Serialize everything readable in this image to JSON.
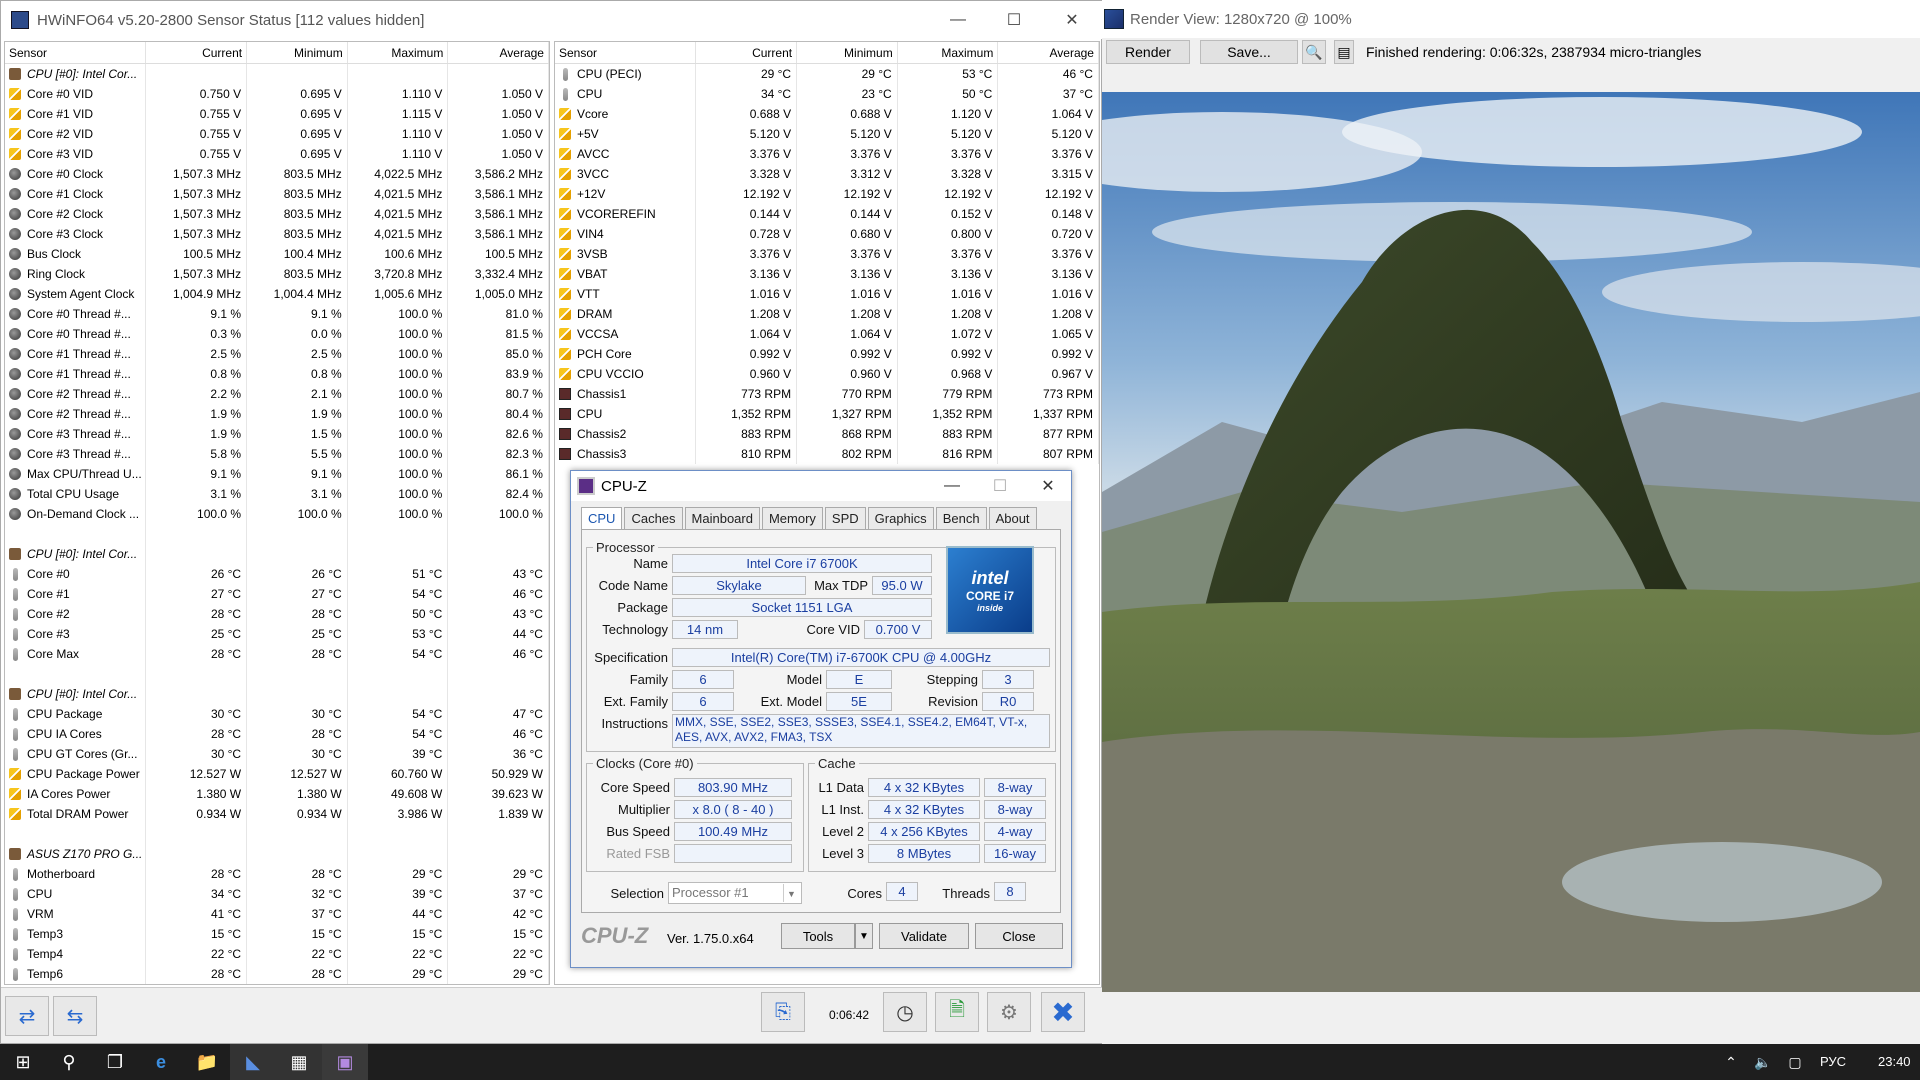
{
  "hwinfo": {
    "title": "HWiNFO64 v5.20-2800 Sensor Status [112 values hidden]",
    "columns": [
      "Sensor",
      "Current",
      "Minimum",
      "Maximum",
      "Average"
    ],
    "left_rows": [
      [
        "grp",
        "CPU [#0]: Intel Cor...",
        "",
        "",
        "",
        ""
      ],
      [
        "bolt",
        "Core #0 VID",
        "0.750 V",
        "0.695 V",
        "1.110 V",
        "1.050 V"
      ],
      [
        "bolt",
        "Core #1 VID",
        "0.755 V",
        "0.695 V",
        "1.115 V",
        "1.050 V"
      ],
      [
        "bolt",
        "Core #2 VID",
        "0.755 V",
        "0.695 V",
        "1.110 V",
        "1.050 V"
      ],
      [
        "bolt",
        "Core #3 VID",
        "0.755 V",
        "0.695 V",
        "1.110 V",
        "1.050 V"
      ],
      [
        "circ",
        "Core #0 Clock",
        "1,507.3 MHz",
        "803.5 MHz",
        "4,022.5 MHz",
        "3,586.2 MHz"
      ],
      [
        "circ",
        "Core #1 Clock",
        "1,507.3 MHz",
        "803.5 MHz",
        "4,021.5 MHz",
        "3,586.1 MHz"
      ],
      [
        "circ",
        "Core #2 Clock",
        "1,507.3 MHz",
        "803.5 MHz",
        "4,021.5 MHz",
        "3,586.1 MHz"
      ],
      [
        "circ",
        "Core #3 Clock",
        "1,507.3 MHz",
        "803.5 MHz",
        "4,021.5 MHz",
        "3,586.1 MHz"
      ],
      [
        "circ",
        "Bus Clock",
        "100.5 MHz",
        "100.4 MHz",
        "100.6 MHz",
        "100.5 MHz"
      ],
      [
        "circ",
        "Ring Clock",
        "1,507.3 MHz",
        "803.5 MHz",
        "3,720.8 MHz",
        "3,332.4 MHz"
      ],
      [
        "circ",
        "System Agent Clock",
        "1,004.9 MHz",
        "1,004.4 MHz",
        "1,005.6 MHz",
        "1,005.0 MHz"
      ],
      [
        "circ",
        "Core #0 Thread #...",
        "9.1 %",
        "9.1 %",
        "100.0 %",
        "81.0 %"
      ],
      [
        "circ",
        "Core #0 Thread #...",
        "0.3 %",
        "0.0 %",
        "100.0 %",
        "81.5 %"
      ],
      [
        "circ",
        "Core #1 Thread #...",
        "2.5 %",
        "2.5 %",
        "100.0 %",
        "85.0 %"
      ],
      [
        "circ",
        "Core #1 Thread #...",
        "0.8 %",
        "0.8 %",
        "100.0 %",
        "83.9 %"
      ],
      [
        "circ",
        "Core #2 Thread #...",
        "2.2 %",
        "2.1 %",
        "100.0 %",
        "80.7 %"
      ],
      [
        "circ",
        "Core #2 Thread #...",
        "1.9 %",
        "1.9 %",
        "100.0 %",
        "80.4 %"
      ],
      [
        "circ",
        "Core #3 Thread #...",
        "1.9 %",
        "1.5 %",
        "100.0 %",
        "82.6 %"
      ],
      [
        "circ",
        "Core #3 Thread #...",
        "5.8 %",
        "5.5 %",
        "100.0 %",
        "82.3 %"
      ],
      [
        "circ",
        "Max CPU/Thread U...",
        "9.1 %",
        "9.1 %",
        "100.0 %",
        "86.1 %"
      ],
      [
        "circ",
        "Total CPU Usage",
        "3.1 %",
        "3.1 %",
        "100.0 %",
        "82.4 %"
      ],
      [
        "circ",
        "On-Demand Clock ...",
        "100.0 %",
        "100.0 %",
        "100.0 %",
        "100.0 %"
      ],
      [
        "blank",
        "",
        "",
        "",
        "",
        ""
      ],
      [
        "grp",
        "CPU [#0]: Intel Cor...",
        "",
        "",
        "",
        ""
      ],
      [
        "temp",
        "Core #0",
        "26 °C",
        "26 °C",
        "51 °C",
        "43 °C"
      ],
      [
        "temp",
        "Core #1",
        "27 °C",
        "27 °C",
        "54 °C",
        "46 °C"
      ],
      [
        "temp",
        "Core #2",
        "28 °C",
        "28 °C",
        "50 °C",
        "43 °C"
      ],
      [
        "temp",
        "Core #3",
        "25 °C",
        "25 °C",
        "53 °C",
        "44 °C"
      ],
      [
        "temp",
        "Core Max",
        "28 °C",
        "28 °C",
        "54 °C",
        "46 °C"
      ],
      [
        "blank",
        "",
        "",
        "",
        "",
        ""
      ],
      [
        "grp",
        "CPU [#0]: Intel Cor...",
        "",
        "",
        "",
        ""
      ],
      [
        "temp",
        "CPU Package",
        "30 °C",
        "30 °C",
        "54 °C",
        "47 °C"
      ],
      [
        "temp",
        "CPU IA Cores",
        "28 °C",
        "28 °C",
        "54 °C",
        "46 °C"
      ],
      [
        "temp",
        "CPU GT Cores (Gr...",
        "30 °C",
        "30 °C",
        "39 °C",
        "36 °C"
      ],
      [
        "bolt",
        "CPU Package Power",
        "12.527 W",
        "12.527 W",
        "60.760 W",
        "50.929 W"
      ],
      [
        "bolt",
        "IA Cores Power",
        "1.380 W",
        "1.380 W",
        "49.608 W",
        "39.623 W"
      ],
      [
        "bolt",
        "Total DRAM Power",
        "0.934 W",
        "0.934 W",
        "3.986 W",
        "1.839 W"
      ],
      [
        "blank",
        "",
        "",
        "",
        "",
        ""
      ],
      [
        "grp",
        "ASUS Z170 PRO G...",
        "",
        "",
        "",
        ""
      ],
      [
        "temp",
        "Motherboard",
        "28 °C",
        "28 °C",
        "29 °C",
        "29 °C"
      ],
      [
        "temp",
        "CPU",
        "34 °C",
        "32 °C",
        "39 °C",
        "37 °C"
      ],
      [
        "temp",
        "VRM",
        "41 °C",
        "37 °C",
        "44 °C",
        "42 °C"
      ],
      [
        "temp",
        "Temp3",
        "15 °C",
        "15 °C",
        "15 °C",
        "15 °C"
      ],
      [
        "temp",
        "Temp4",
        "22 °C",
        "22 °C",
        "22 °C",
        "22 °C"
      ],
      [
        "temp",
        "Temp6",
        "28 °C",
        "28 °C",
        "29 °C",
        "29 °C"
      ]
    ],
    "right_rows": [
      [
        "temp",
        "CPU (PECI)",
        "29 °C",
        "29 °C",
        "53 °C",
        "46 °C"
      ],
      [
        "temp",
        "CPU",
        "34 °C",
        "23 °C",
        "50 °C",
        "37 °C"
      ],
      [
        "bolt",
        "Vcore",
        "0.688 V",
        "0.688 V",
        "1.120 V",
        "1.064 V"
      ],
      [
        "bolt",
        "+5V",
        "5.120 V",
        "5.120 V",
        "5.120 V",
        "5.120 V"
      ],
      [
        "bolt",
        "AVCC",
        "3.376 V",
        "3.376 V",
        "3.376 V",
        "3.376 V"
      ],
      [
        "bolt",
        "3VCC",
        "3.328 V",
        "3.312 V",
        "3.328 V",
        "3.315 V"
      ],
      [
        "bolt",
        "+12V",
        "12.192 V",
        "12.192 V",
        "12.192 V",
        "12.192 V"
      ],
      [
        "bolt",
        "VCOREREFIN",
        "0.144 V",
        "0.144 V",
        "0.152 V",
        "0.148 V"
      ],
      [
        "bolt",
        "VIN4",
        "0.728 V",
        "0.680 V",
        "0.800 V",
        "0.720 V"
      ],
      [
        "bolt",
        "3VSB",
        "3.376 V",
        "3.376 V",
        "3.376 V",
        "3.376 V"
      ],
      [
        "bolt",
        "VBAT",
        "3.136 V",
        "3.136 V",
        "3.136 V",
        "3.136 V"
      ],
      [
        "bolt",
        "VTT",
        "1.016 V",
        "1.016 V",
        "1.016 V",
        "1.016 V"
      ],
      [
        "bolt",
        "DRAM",
        "1.208 V",
        "1.208 V",
        "1.208 V",
        "1.208 V"
      ],
      [
        "bolt",
        "VCCSA",
        "1.064 V",
        "1.064 V",
        "1.072 V",
        "1.065 V"
      ],
      [
        "bolt",
        "PCH Core",
        "0.992 V",
        "0.992 V",
        "0.992 V",
        "0.992 V"
      ],
      [
        "bolt",
        "CPU VCCIO",
        "0.960 V",
        "0.960 V",
        "0.968 V",
        "0.967 V"
      ],
      [
        "fan",
        "Chassis1",
        "773 RPM",
        "770 RPM",
        "779 RPM",
        "773 RPM"
      ],
      [
        "fan",
        "CPU",
        "1,352 RPM",
        "1,327 RPM",
        "1,352 RPM",
        "1,337 RPM"
      ],
      [
        "fan",
        "Chassis2",
        "883 RPM",
        "868 RPM",
        "883 RPM",
        "877 RPM"
      ],
      [
        "fan",
        "Chassis3",
        "810 RPM",
        "802 RPM",
        "816 RPM",
        "807 RPM"
      ]
    ],
    "elapsed": "0:06:42"
  },
  "render": {
    "title": "Render View: 1280x720 @ 100%",
    "render_btn": "Render",
    "save_btn": "Save...",
    "status": "Finished rendering:  0:06:32s, 2387934 micro-triangles"
  },
  "cpuz": {
    "title": "CPU-Z",
    "tabs": [
      "CPU",
      "Caches",
      "Mainboard",
      "Memory",
      "SPD",
      "Graphics",
      "Bench",
      "About"
    ],
    "processor_legend": "Processor",
    "name_lbl": "Name",
    "name": "Intel Core i7 6700K",
    "codename_lbl": "Code Name",
    "codename": "Skylake",
    "maxtdp_lbl": "Max TDP",
    "maxtdp": "95.0 W",
    "package_lbl": "Package",
    "package": "Socket 1151 LGA",
    "tech_lbl": "Technology",
    "tech": "14 nm",
    "corevid_lbl": "Core VID",
    "corevid": "0.700 V",
    "spec_lbl": "Specification",
    "spec": "Intel(R) Core(TM) i7-6700K CPU @ 4.00GHz",
    "family_lbl": "Family",
    "family": "6",
    "model_lbl": "Model",
    "model": "E",
    "stepping_lbl": "Stepping",
    "stepping": "3",
    "extfamily_lbl": "Ext. Family",
    "extfamily": "6",
    "extmodel_lbl": "Ext. Model",
    "extmodel": "5E",
    "revision_lbl": "Revision",
    "revision": "R0",
    "instr_lbl": "Instructions",
    "instr": "MMX, SSE, SSE2, SSE3, SSSE3, SSE4.1, SSE4.2, EM64T, VT-x, AES, AVX, AVX2, FMA3, TSX",
    "clocks_legend": "Clocks (Core #0)",
    "corespeed_lbl": "Core Speed",
    "corespeed": "803.90 MHz",
    "mult_lbl": "Multiplier",
    "mult": "x 8.0 ( 8 - 40 )",
    "bus_lbl": "Bus Speed",
    "bus": "100.49 MHz",
    "fsb_lbl": "Rated FSB",
    "fsb": "",
    "cache_legend": "Cache",
    "l1d_lbl": "L1 Data",
    "l1d": "4 x 32 KBytes",
    "l1d_way": "8-way",
    "l1i_lbl": "L1 Inst.",
    "l1i": "4 x 32 KBytes",
    "l1i_way": "8-way",
    "l2_lbl": "Level 2",
    "l2": "4 x 256 KBytes",
    "l2_way": "4-way",
    "l3_lbl": "Level 3",
    "l3": "8 MBytes",
    "l3_way": "16-way",
    "sel_lbl": "Selection",
    "sel": "Processor #1",
    "cores_lbl": "Cores",
    "cores": "4",
    "threads_lbl": "Threads",
    "threads": "8",
    "brand": "CPU-Z",
    "ver": "Ver. 1.75.0.x64",
    "tools": "Tools",
    "validate": "Validate",
    "close": "Close",
    "logo_text": "intel CORE i7 inside"
  },
  "taskbar": {
    "lang": "РУС",
    "time": "23:40"
  }
}
